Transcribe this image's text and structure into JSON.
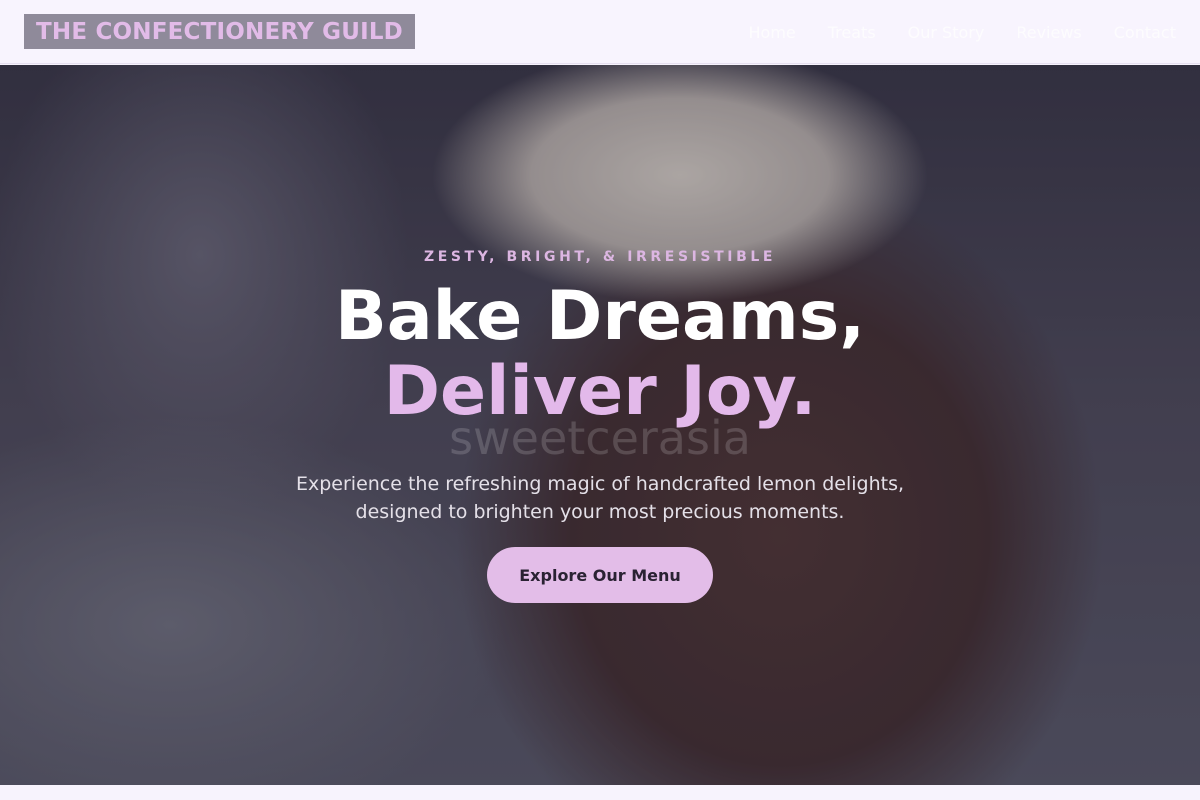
{
  "header": {
    "brand": "THE CONFECTIONERY GUILD",
    "nav": [
      {
        "label": "Home"
      },
      {
        "label": "Treats"
      },
      {
        "label": "Our Story"
      },
      {
        "label": "Reviews"
      },
      {
        "label": "Contact"
      }
    ]
  },
  "hero": {
    "eyebrow": "ZESTY, BRIGHT, & IRRESISTIBLE",
    "headline_line1": "Bake Dreams,",
    "headline_line2": "Deliver Joy.",
    "watermark": "sweetcerasia",
    "subtext": "Experience the refreshing magic of handcrafted lemon delights, designed to brighten your most precious moments.",
    "cta_label": "Explore Our Menu",
    "background_image": "brownie-with-ice-cream-photo"
  },
  "colors": {
    "accent": "#e3bde8",
    "header_bg": "#f8f4fe",
    "logo_bg": "#8f8a9a",
    "headline_white": "#ffffff",
    "cta_text": "#2a2233"
  }
}
